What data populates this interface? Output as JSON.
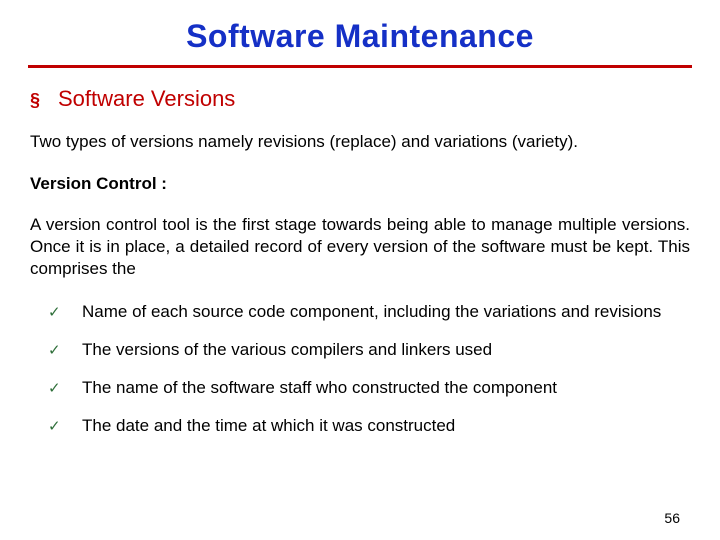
{
  "title": "Software Maintenance",
  "section": {
    "heading": "Software Versions"
  },
  "intro": "Two types of versions namely revisions (replace) and variations (variety).",
  "vc_label": "Version Control :",
  "vc_desc": "A version control tool is the first stage towards being able to manage multiple versions. Once it is in place, a detailed record of every version of the software must be kept. This comprises the",
  "items": [
    "Name of each source code component, including the variations and revisions",
    "The versions of the various compilers and linkers used",
    "The name of the software staff who constructed the component",
    "The date and the time at which it was constructed"
  ],
  "page_number": "56"
}
